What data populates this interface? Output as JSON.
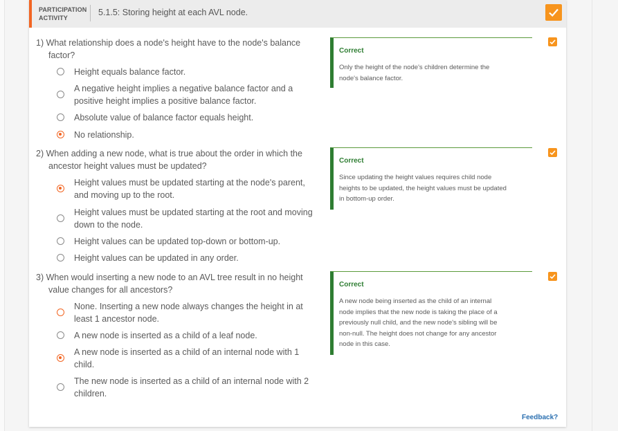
{
  "activity": {
    "label_line1": "PARTICIPATION",
    "label_line2": "ACTIVITY",
    "title": "5.1.5: Storing height at each AVL node."
  },
  "questions": [
    {
      "title_line1": "1) What relationship does a node's height have to the node's balance",
      "title_line2": "factor?",
      "options": [
        {
          "line1": "Height equals balance factor.",
          "line2": "",
          "state": "unselected"
        },
        {
          "line1": "A negative height implies a negative balance factor and a",
          "line2": "positive height implies a positive balance factor.",
          "state": "unselected"
        },
        {
          "line1": "Absolute value of balance factor equals height.",
          "line2": "",
          "state": "unselected"
        },
        {
          "line1": "No relationship.",
          "line2": "",
          "state": "selected"
        }
      ],
      "feedback": {
        "status": "Correct",
        "lines": [
          "Only the height of the node's children determine the",
          "node's balance factor."
        ]
      }
    },
    {
      "title_line1": "2) When adding a new node, what is true about the order in which the",
      "title_line2": "ancestor height values must be updated?",
      "options": [
        {
          "line1": "Height values must be updated starting at the node's parent,",
          "line2": "and moving up to the root.",
          "state": "selected"
        },
        {
          "line1": "Height values must be updated starting at the root and moving",
          "line2": "down to the node.",
          "state": "unselected"
        },
        {
          "line1": "Height values can be updated top-down or bottom-up.",
          "line2": "",
          "state": "unselected"
        },
        {
          "line1": "Height values can be updated in any order.",
          "line2": "",
          "state": "unselected"
        }
      ],
      "feedback": {
        "status": "Correct",
        "lines": [
          "Since updating the height values requires child node",
          "heights to be updated, the height values must be updated",
          "in bottom-up order."
        ]
      }
    },
    {
      "title_line1": "3) When would inserting a new node to an AVL tree result in no height",
      "title_line2": "value changes for all ancestors?",
      "options": [
        {
          "line1": "None. Inserting a new node always changes the height in at",
          "line2": "least 1 ancestor node.",
          "state": "wrong"
        },
        {
          "line1": "A new node is inserted as a child of a leaf node.",
          "line2": "",
          "state": "unselected"
        },
        {
          "line1": "A new node is inserted as a child of an internal node with 1",
          "line2": "child.",
          "state": "selected"
        },
        {
          "line1": "The new node is inserted as a child of an internal node with 2",
          "line2": "children.",
          "state": "unselected"
        }
      ],
      "feedback": {
        "status": "Correct",
        "lines": [
          "A new node being inserted as the child of an internal",
          "node implies that the new node is taking the place of a",
          "previously null child, and the new node's sibling will be",
          "non-null. The height does not change for any ancestor",
          "node in this case."
        ]
      }
    }
  ],
  "feedback_link": "Feedback?",
  "colors": {
    "accent": "#f26522",
    "check": "#f7941d",
    "correct": "#2e7d32",
    "link": "#2a6fb0"
  }
}
